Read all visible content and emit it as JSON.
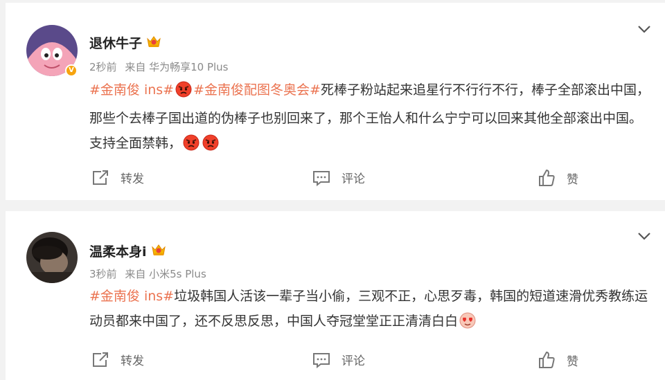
{
  "posts": [
    {
      "username": "退休牛子",
      "verified_badge": "V",
      "time": "2秒前",
      "source": "来自 华为畅享10 Plus",
      "content": [
        {
          "type": "topic",
          "text": "#金南俊 ins#"
        },
        {
          "type": "emoji",
          "icon": "angry-face-emoji"
        },
        {
          "type": "topic",
          "text": "#金南俊配图冬奥会#"
        },
        {
          "type": "text",
          "text": "死棒子粉站起来追星行不行行不行，棒子全部滚出中国，那些个去棒子国出道的伪棒子也别回来了，那个王怡人和什么宁宁可以回来其他全部滚出中国。支持全面禁韩，"
        },
        {
          "type": "emoji",
          "icon": "angry-face-emoji"
        },
        {
          "type": "emoji",
          "icon": "angry-face-emoji"
        }
      ],
      "actions": {
        "repost": "转发",
        "comment": "评论",
        "like": "赞"
      }
    },
    {
      "username": "温柔本身i",
      "time": "3秒前",
      "source": "来自 小米5s Plus",
      "content": [
        {
          "type": "topic",
          "text": "#金南俊 ins#"
        },
        {
          "type": "text",
          "text": "垃圾韩国人活该一辈子当小偷，三观不正，心思歹毒，韩国的短道速滑优秀教练运动员都来中国了，还不反思反思，中国人夺冠堂堂正正清清白白"
        },
        {
          "type": "emoji",
          "icon": "heart-eyes-emoji"
        }
      ],
      "actions": {
        "repost": "转发",
        "comment": "评论",
        "like": "赞"
      }
    }
  ],
  "colors": {
    "topic": "#eb7350",
    "meta": "#8a8a8a",
    "verified": "#f7a40e",
    "background": "#f2f2f2"
  }
}
